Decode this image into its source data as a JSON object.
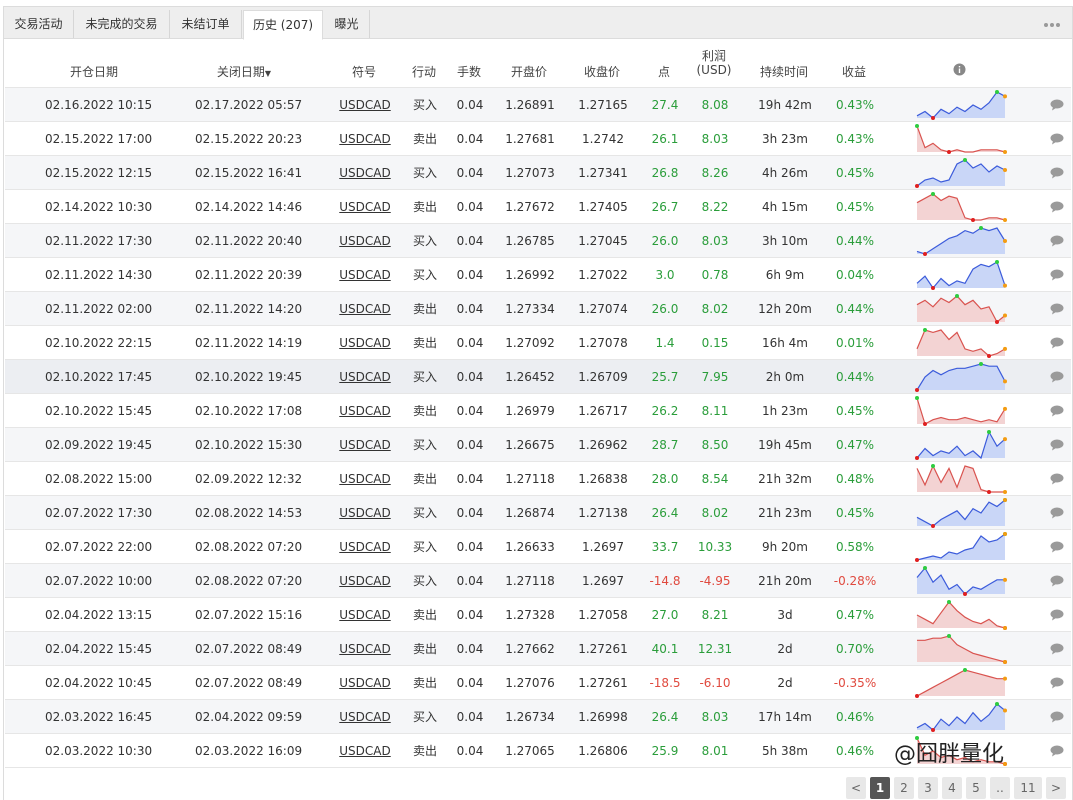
{
  "tabs": [
    {
      "label": "交易活动"
    },
    {
      "label": "未完成的交易"
    },
    {
      "label": "未结订单"
    },
    {
      "label": "历史 (207)"
    },
    {
      "label": "曝光"
    }
  ],
  "columns": {
    "open_date": "开仓日期",
    "close_date": "关闭日期",
    "symbol": "符号",
    "action": "行动",
    "lots": "手数",
    "open_price": "开盘价",
    "close_price": "收盘价",
    "pips": "点",
    "profit_line1": "利润",
    "profit_line2": "(USD)",
    "duration": "持续时间",
    "gain": "收益"
  },
  "rows": [
    {
      "open": "02.16.2022 10:15",
      "close": "02.17.2022 05:57",
      "symbol": "USDCAD",
      "action": "买入",
      "lots": "0.04",
      "open_price": "1.26891",
      "close_price": "1.27165",
      "pips": "27.4",
      "profit": "8.08",
      "duration": "19h 42m",
      "gain": "0.43%",
      "spark": [
        3,
        5,
        2,
        6,
        4,
        7,
        5,
        8,
        6,
        9,
        14,
        12
      ],
      "dir": "buy"
    },
    {
      "open": "02.15.2022 17:00",
      "close": "02.15.2022 20:23",
      "symbol": "USDCAD",
      "action": "卖出",
      "lots": "0.04",
      "open_price": "1.27681",
      "close_price": "1.2742",
      "pips": "26.1",
      "profit": "8.03",
      "duration": "3h 23m",
      "gain": "0.43%",
      "spark": [
        14,
        4,
        6,
        3,
        2,
        3,
        2,
        2,
        3,
        3,
        3,
        2
      ],
      "dir": "sell"
    },
    {
      "open": "02.15.2022 12:15",
      "close": "02.15.2022 16:41",
      "symbol": "USDCAD",
      "action": "买入",
      "lots": "0.04",
      "open_price": "1.27073",
      "close_price": "1.27341",
      "pips": "26.8",
      "profit": "8.26",
      "duration": "4h 26m",
      "gain": "0.45%",
      "spark": [
        1,
        4,
        5,
        3,
        4,
        12,
        14,
        10,
        12,
        8,
        11,
        9
      ],
      "dir": "buy"
    },
    {
      "open": "02.14.2022 10:30",
      "close": "02.14.2022 14:46",
      "symbol": "USDCAD",
      "action": "卖出",
      "lots": "0.04",
      "open_price": "1.27672",
      "close_price": "1.27405",
      "pips": "26.7",
      "profit": "8.22",
      "duration": "4h 15m",
      "gain": "0.45%",
      "spark": [
        10,
        12,
        14,
        11,
        13,
        12,
        3,
        2,
        2,
        3,
        3,
        2
      ],
      "dir": "sell"
    },
    {
      "open": "02.11.2022 17:30",
      "close": "02.11.2022 20:40",
      "symbol": "USDCAD",
      "action": "买入",
      "lots": "0.04",
      "open_price": "1.26785",
      "close_price": "1.27045",
      "pips": "26.0",
      "profit": "8.03",
      "duration": "3h 10m",
      "gain": "0.44%",
      "spark": [
        3,
        2,
        4,
        6,
        8,
        9,
        11,
        10,
        12,
        11,
        12,
        7
      ],
      "dir": "buy"
    },
    {
      "open": "02.11.2022 14:30",
      "close": "02.11.2022 20:39",
      "symbol": "USDCAD",
      "action": "买入",
      "lots": "0.04",
      "open_price": "1.26992",
      "close_price": "1.27022",
      "pips": "3.0",
      "profit": "0.78",
      "duration": "6h 9m",
      "gain": "0.04%",
      "spark": [
        6,
        9,
        4,
        8,
        5,
        7,
        6,
        12,
        14,
        13,
        15,
        5
      ],
      "dir": "buy"
    },
    {
      "open": "02.11.2022 02:00",
      "close": "02.11.2022 14:20",
      "symbol": "USDCAD",
      "action": "卖出",
      "lots": "0.04",
      "open_price": "1.27334",
      "close_price": "1.27074",
      "pips": "26.0",
      "profit": "8.02",
      "duration": "12h 20m",
      "gain": "0.44%",
      "spark": [
        10,
        12,
        9,
        13,
        11,
        14,
        10,
        12,
        8,
        9,
        2,
        5
      ],
      "dir": "sell"
    },
    {
      "open": "02.10.2022 22:15",
      "close": "02.11.2022 14:19",
      "symbol": "USDCAD",
      "action": "卖出",
      "lots": "0.04",
      "open_price": "1.27092",
      "close_price": "1.27078",
      "pips": "1.4",
      "profit": "0.15",
      "duration": "16h 4m",
      "gain": "0.01%",
      "spark": [
        6,
        14,
        13,
        14,
        10,
        13,
        6,
        5,
        6,
        3,
        4,
        6
      ],
      "dir": "sell"
    },
    {
      "open": "02.10.2022 17:45",
      "close": "02.10.2022 19:45",
      "symbol": "USDCAD",
      "action": "买入",
      "lots": "0.04",
      "open_price": "1.26452",
      "close_price": "1.26709",
      "pips": "25.7",
      "profit": "7.95",
      "duration": "2h 0m",
      "gain": "0.44%",
      "spark": [
        2,
        8,
        11,
        9,
        11,
        12,
        12,
        13,
        14,
        13,
        13,
        6
      ],
      "dir": "buy"
    },
    {
      "open": "02.10.2022 15:45",
      "close": "02.10.2022 17:08",
      "symbol": "USDCAD",
      "action": "卖出",
      "lots": "0.04",
      "open_price": "1.26979",
      "close_price": "1.26717",
      "pips": "26.2",
      "profit": "8.11",
      "duration": "1h 23m",
      "gain": "0.45%",
      "spark": [
        14,
        2,
        4,
        5,
        4,
        4,
        5,
        4,
        3,
        4,
        3,
        9
      ],
      "dir": "sell"
    },
    {
      "open": "02.09.2022 19:45",
      "close": "02.10.2022 15:30",
      "symbol": "USDCAD",
      "action": "买入",
      "lots": "0.04",
      "open_price": "1.26675",
      "close_price": "1.26962",
      "pips": "28.7",
      "profit": "8.50",
      "duration": "19h 45m",
      "gain": "0.47%",
      "spark": [
        3,
        7,
        4,
        6,
        5,
        8,
        4,
        6,
        3,
        14,
        8,
        11
      ],
      "dir": "buy"
    },
    {
      "open": "02.08.2022 15:00",
      "close": "02.09.2022 12:32",
      "symbol": "USDCAD",
      "action": "卖出",
      "lots": "0.04",
      "open_price": "1.27118",
      "close_price": "1.26838",
      "pips": "28.0",
      "profit": "8.54",
      "duration": "21h 32m",
      "gain": "0.48%",
      "spark": [
        12,
        5,
        13,
        6,
        12,
        4,
        13,
        12,
        3,
        2,
        2,
        2
      ],
      "dir": "sell"
    },
    {
      "open": "02.07.2022 17:30",
      "close": "02.08.2022 14:53",
      "symbol": "USDCAD",
      "action": "买入",
      "lots": "0.04",
      "open_price": "1.26874",
      "close_price": "1.27138",
      "pips": "26.4",
      "profit": "8.02",
      "duration": "21h 23m",
      "gain": "0.45%",
      "spark": [
        6,
        4,
        2,
        5,
        7,
        9,
        5,
        10,
        8,
        13,
        11,
        14
      ],
      "dir": "buy"
    },
    {
      "open": "02.07.2022 22:00",
      "close": "02.08.2022 07:20",
      "symbol": "USDCAD",
      "action": "买入",
      "lots": "0.04",
      "open_price": "1.26633",
      "close_price": "1.2697",
      "pips": "33.7",
      "profit": "10.33",
      "duration": "9h 20m",
      "gain": "0.58%",
      "spark": [
        2,
        3,
        4,
        3,
        6,
        5,
        7,
        8,
        14,
        11,
        12,
        15
      ],
      "dir": "buy"
    },
    {
      "open": "02.07.2022 10:00",
      "close": "02.08.2022 07:20",
      "symbol": "USDCAD",
      "action": "买入",
      "lots": "0.04",
      "open_price": "1.27118",
      "close_price": "1.2697",
      "pips": "-14.8",
      "profit": "-4.95",
      "duration": "21h 20m",
      "gain": "-0.28%",
      "spark": [
        10,
        14,
        8,
        11,
        5,
        7,
        3,
        6,
        5,
        7,
        9,
        9
      ],
      "dir": "buy"
    },
    {
      "open": "02.04.2022 13:15",
      "close": "02.07.2022 15:16",
      "symbol": "USDCAD",
      "action": "卖出",
      "lots": "0.04",
      "open_price": "1.27328",
      "close_price": "1.27058",
      "pips": "27.0",
      "profit": "8.21",
      "duration": "3d",
      "gain": "0.47%",
      "spark": [
        8,
        6,
        4,
        9,
        14,
        10,
        7,
        5,
        4,
        6,
        3,
        2
      ],
      "dir": "sell"
    },
    {
      "open": "02.04.2022 15:45",
      "close": "02.07.2022 08:49",
      "symbol": "USDCAD",
      "action": "卖出",
      "lots": "0.04",
      "open_price": "1.27662",
      "close_price": "1.27261",
      "pips": "40.1",
      "profit": "12.31",
      "duration": "2d",
      "gain": "0.70%",
      "spark": [
        12,
        12,
        13,
        13,
        14,
        10,
        8,
        6,
        5,
        4,
        3,
        2
      ],
      "dir": "sell"
    },
    {
      "open": "02.04.2022 10:45",
      "close": "02.07.2022 08:49",
      "symbol": "USDCAD",
      "action": "卖出",
      "lots": "0.04",
      "open_price": "1.27076",
      "close_price": "1.27261",
      "pips": "-18.5",
      "profit": "-6.10",
      "duration": "2d",
      "gain": "-0.35%",
      "spark": [
        2,
        4,
        6,
        8,
        10,
        12,
        14,
        13,
        12,
        11,
        10,
        10
      ],
      "dir": "sell"
    },
    {
      "open": "02.03.2022 16:45",
      "close": "02.04.2022 09:59",
      "symbol": "USDCAD",
      "action": "买入",
      "lots": "0.04",
      "open_price": "1.26734",
      "close_price": "1.26998",
      "pips": "26.4",
      "profit": "8.03",
      "duration": "17h 14m",
      "gain": "0.46%",
      "spark": [
        4,
        6,
        3,
        8,
        5,
        9,
        6,
        11,
        7,
        10,
        15,
        12
      ],
      "dir": "buy"
    },
    {
      "open": "02.03.2022 10:30",
      "close": "02.03.2022 16:09",
      "symbol": "USDCAD",
      "action": "卖出",
      "lots": "0.04",
      "open_price": "1.27065",
      "close_price": "1.26806",
      "pips": "25.9",
      "profit": "8.01",
      "duration": "5h 38m",
      "gain": "0.46%",
      "spark": [
        14,
        6,
        8,
        5,
        6,
        4,
        5,
        3,
        4,
        3,
        3,
        2
      ],
      "dir": "sell"
    }
  ],
  "pager": {
    "prev": "<",
    "pages": [
      "1",
      "2",
      "3",
      "4",
      "5",
      "..",
      "11"
    ],
    "next": ">",
    "current": "1"
  },
  "watermark": "@囧胖量化",
  "colors": {
    "positive": "#2a9d3a",
    "negative": "#e04a3f",
    "buy_line": "#3b5bdb",
    "buy_fill": "#c9d6f7",
    "sell_line": "#d9534f",
    "sell_fill": "#f3d3d3"
  }
}
